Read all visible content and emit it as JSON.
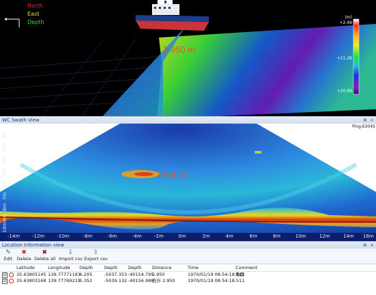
{
  "view3d": {
    "axis_legend": {
      "north": "North",
      "east": "East",
      "depth": "Depth"
    },
    "depth_readout": "2.950 m",
    "colorbar": {
      "unit": "(m)",
      "top": "+2.49",
      "middle": "+11.29",
      "bottom": "+20.09"
    }
  },
  "swath_panel": {
    "title": "WC Swath View",
    "close_glyph": "×",
    "pin_glyph": "⊕",
    "ping_label": "Ping:63045",
    "depth_readout": "2.950 m",
    "y_ticks": [
      "2m",
      "3m",
      "4m",
      "5m",
      "6m",
      "7m",
      "8m",
      "9m",
      "10m"
    ],
    "x_ticks": [
      "-14m",
      "-12m",
      "-10m",
      "-8m",
      "-6m",
      "-4m",
      "-2m",
      "0m",
      "2m",
      "4m",
      "6m",
      "8m",
      "10m",
      "12m",
      "14m",
      "16m"
    ]
  },
  "location_panel": {
    "title": "Location information view",
    "close_glyph": "×",
    "pin_glyph": "⊕",
    "toolbar": [
      {
        "label": "Edit",
        "icon": "pencil-icon",
        "glyph": "✎"
      },
      {
        "label": "Delete",
        "icon": "delete-icon",
        "glyph": "✖"
      },
      {
        "label": "Delete all",
        "icon": "delete-all-icon",
        "glyph": "✖"
      },
      {
        "label": "Import csv",
        "icon": "import-icon",
        "glyph": "⇩"
      },
      {
        "label": "Export csv",
        "icon": "export-icon",
        "glyph": "⇧"
      }
    ],
    "columns": [
      "Latitude",
      "Longitude",
      "Depth",
      "Depth",
      "Depth",
      "Distance",
      "Time",
      "Comment"
    ],
    "rows": [
      {
        "checked": "☑",
        "latitude": "35.63805145",
        "longitude": "139.77771183",
        "depth1": "6.205",
        "depth2": "-5037.353",
        "depth3": "-40154.795",
        "distance": "2.950",
        "time": "1970/01/19 08:54:18.511",
        "comment": "魚群"
      },
      {
        "checked": "☑",
        "latitude": "35.63803168",
        "longitude": "139.77769219",
        "depth1": "5.352",
        "depth2": "-5039.132",
        "depth3": "-40156.988",
        "distance": "合計 2.950",
        "time": "1970/01/19 08:54:18.511",
        "comment": ""
      }
    ]
  }
}
